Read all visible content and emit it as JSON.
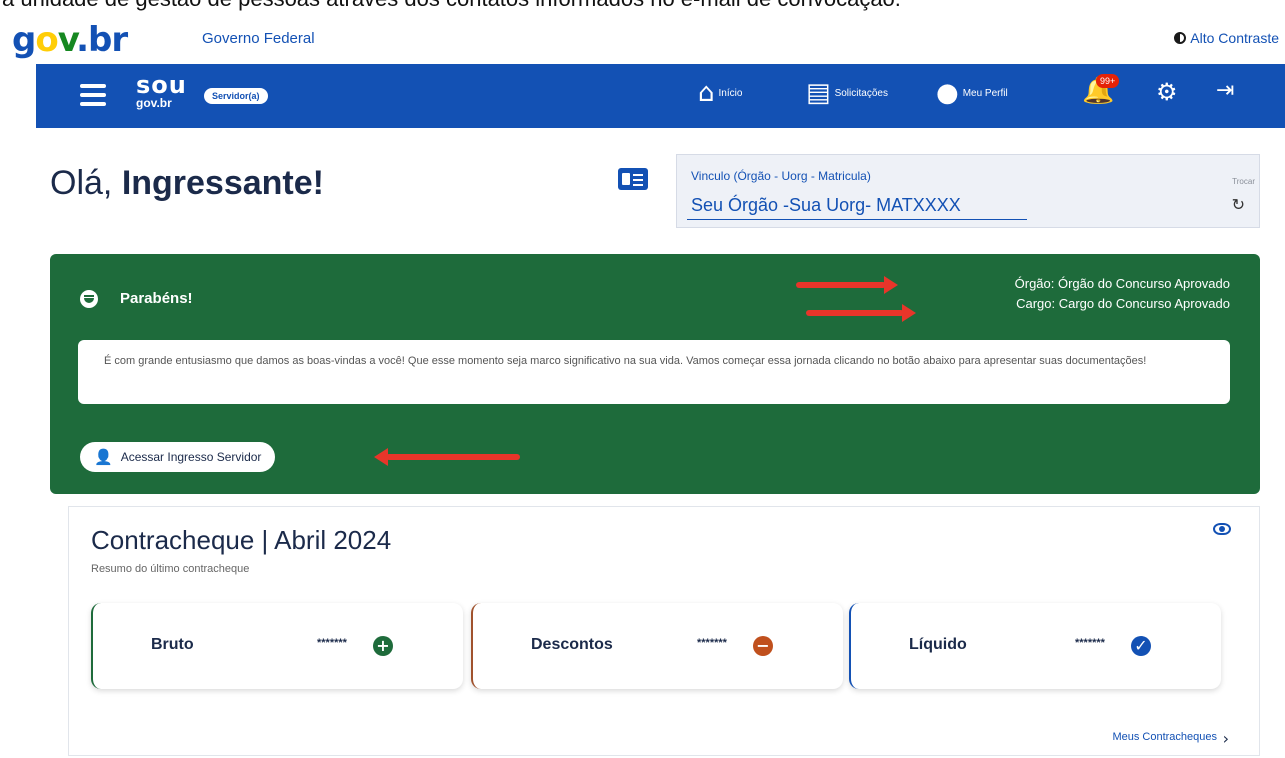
{
  "caption": "a unidade de gestão de pessoas através dos contatos informados no e-mail de convocação.",
  "govbar": {
    "logo": {
      "g": "g",
      "o": "o",
      "v": "v",
      "br": ".br"
    },
    "name": "Governo Federal",
    "contrast_label": "Alto Contraste"
  },
  "navbar": {
    "brand_big": "sou",
    "brand_small": "gov.br",
    "badge": "Servidor(a)",
    "items": [
      {
        "label": "Início",
        "icon": "home-icon"
      },
      {
        "label": "Solicitações",
        "icon": "clipboard-icon"
      },
      {
        "label": "Meu Perfil",
        "icon": "user-icon"
      }
    ],
    "notifications_count": "99+"
  },
  "greeting": {
    "hello": "Olá,",
    "name": "Ingressante!"
  },
  "vinculo": {
    "label": "Vinculo (Órgão - Uorg - Matricula)",
    "value": "Seu Órgão -Sua Uorg- MATXXXX",
    "trocar": "Trocar"
  },
  "congrats": {
    "title": "Parabéns!",
    "orgao": "Órgão: Órgão do Concurso Aprovado",
    "cargo": "Cargo: Cargo do Concurso Aprovado",
    "message": "É com grande entusiasmo que damos as boas-vindas a você! Que esse momento seja marco significativo na sua vida. Vamos começar essa jornada clicando no botão abaixo para apresentar suas documentações!",
    "button": "Acessar Ingresso Servidor"
  },
  "contracheque": {
    "title": "Contracheque | Abril 2024",
    "subtitle": "Resumo do último contracheque",
    "boxes": [
      {
        "label": "Bruto",
        "value": "*******",
        "accent": "#1e6b3b"
      },
      {
        "label": "Descontos",
        "value": "*******",
        "accent": "#a0522d"
      },
      {
        "label": "Líquido",
        "value": "*******",
        "accent": "#1351b4"
      }
    ],
    "link": "Meus Contracheques"
  },
  "colors": {
    "primary": "#1351b4",
    "success_bg": "#1e6b3b",
    "alert": "#e8352a"
  }
}
